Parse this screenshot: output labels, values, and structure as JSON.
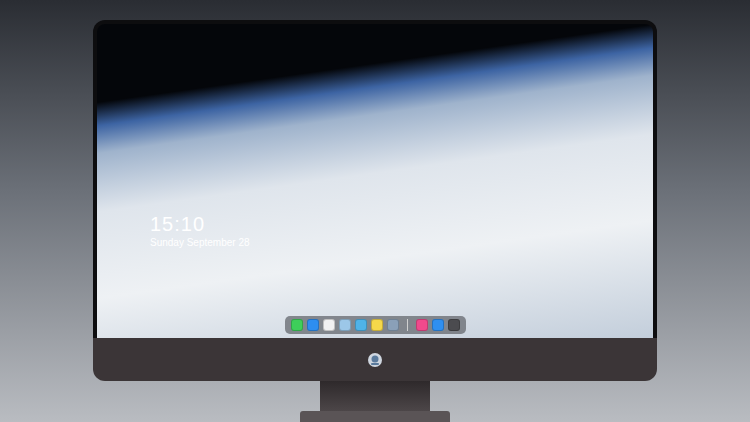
{
  "desktop": {
    "clock": {
      "time": "15:10",
      "date": "Sunday September 28"
    },
    "wallpaper": {
      "kind": "photo"
    }
  },
  "dock": {
    "items": [
      {
        "name": "messages",
        "color": "#3ecf5a",
        "group": "apps"
      },
      {
        "name": "finder",
        "color": "#2d8ef0",
        "group": "apps"
      },
      {
        "name": "safari",
        "color": "#f2f2f2",
        "group": "apps"
      },
      {
        "name": "preview",
        "color": "#9cc7e8",
        "group": "apps"
      },
      {
        "name": "videos",
        "color": "#4fb3e8",
        "group": "apps"
      },
      {
        "name": "notes",
        "color": "#f5d84a",
        "group": "apps"
      },
      {
        "name": "photos",
        "color": "#8aa0b8",
        "group": "apps"
      },
      {
        "name": "music",
        "color": "#f04a8c",
        "group": "extras"
      },
      {
        "name": "app-store",
        "color": "#2f8ff0",
        "group": "extras"
      },
      {
        "name": "camera",
        "color": "#4b4b4f",
        "group": "extras"
      }
    ]
  }
}
